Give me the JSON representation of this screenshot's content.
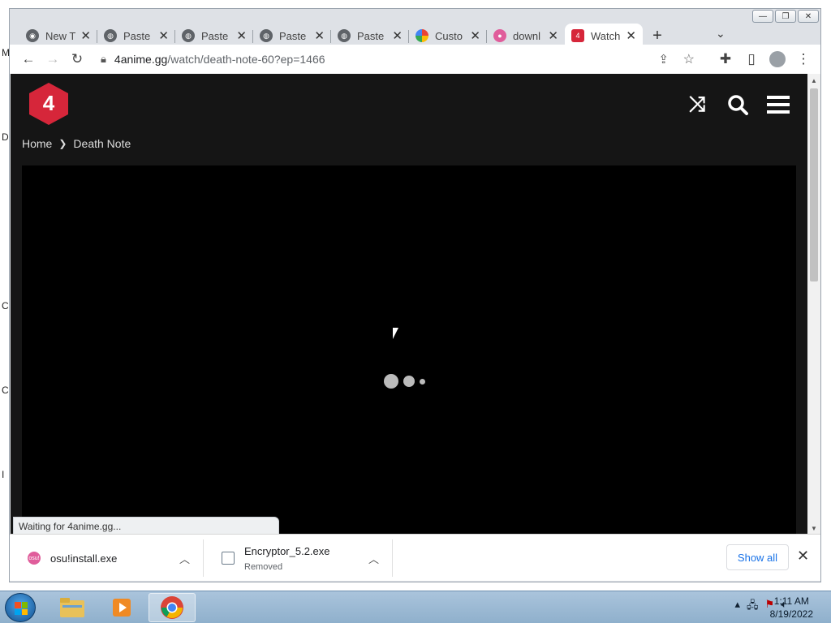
{
  "desktop": {
    "edge_letters": [
      "M",
      "D",
      "C",
      "C",
      "I"
    ]
  },
  "window": {
    "controls": [
      "—",
      "❐",
      "✕"
    ]
  },
  "tabs": [
    {
      "title": "New T",
      "icon": "chrome-icon",
      "color": "#5f6368"
    },
    {
      "title": "Paste",
      "icon": "globe-icon",
      "color": "#5f6368"
    },
    {
      "title": "Paste",
      "icon": "globe-icon",
      "color": "#5f6368"
    },
    {
      "title": "Paste",
      "icon": "globe-icon",
      "color": "#5f6368"
    },
    {
      "title": "Paste",
      "icon": "globe-icon",
      "color": "#5f6368"
    },
    {
      "title": "Custo",
      "icon": "google-icon",
      "color": "#ea4335"
    },
    {
      "title": "downl",
      "icon": "osu-icon",
      "color": "#e05d9b"
    },
    {
      "title": "Watch",
      "icon": "4anime-icon",
      "color": "#d6263a",
      "active": true
    }
  ],
  "tab_close_glyph": "✕",
  "toolbar": {
    "url_host": "4anime.gg",
    "url_path": "/watch/death-note-60?ep=1466"
  },
  "site": {
    "logo_text": "4",
    "accent": "#d6263a",
    "breadcrumb": {
      "home": "Home",
      "current": "Death Note"
    }
  },
  "status_text": "Waiting for 4anime.gg...",
  "downloads": [
    {
      "name": "osu!install.exe",
      "sub": "",
      "icon_text": "osu!"
    },
    {
      "name": "Encryptor_5.2.exe",
      "sub": "Removed",
      "icon_text": ""
    }
  ],
  "shelf": {
    "show_all": "Show all"
  },
  "taskbar": {
    "time": "1:11 AM",
    "date": "8/19/2022"
  }
}
